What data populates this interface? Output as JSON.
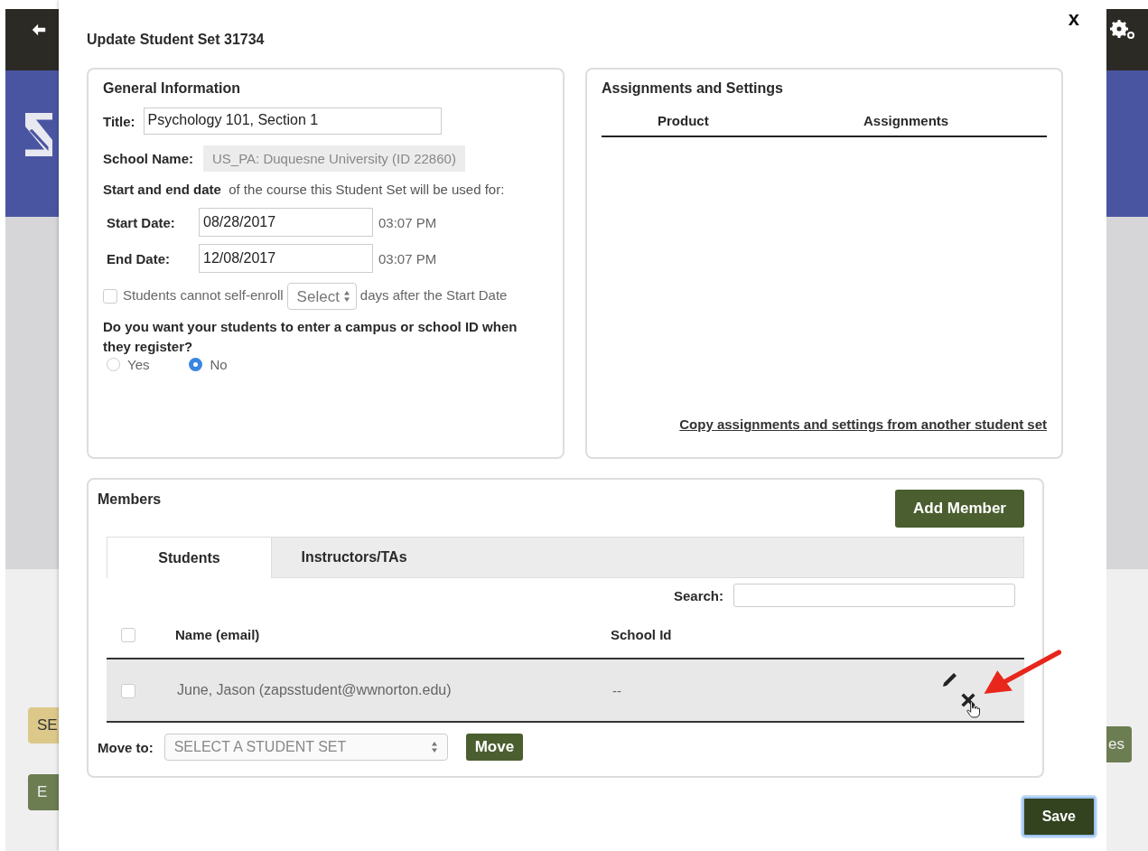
{
  "background": {
    "left_buttons": [
      "SE",
      "E"
    ],
    "right_buttons": [
      "es"
    ]
  },
  "dialog": {
    "title": "Update Student Set 31734",
    "close": "x"
  },
  "general_information": {
    "heading": "General Information",
    "title_label": "Title:",
    "title_value": "Psychology 101, Section 1",
    "school_label": "School Name:",
    "school_value": "US_PA: Duquesne University (ID 22860)",
    "dates_intro_bold": "Start and end date",
    "dates_intro_rest": "of the course this Student Set will be used for:",
    "dates": [
      {
        "label": "Start Date:",
        "value": "08/28/2017",
        "time": "03:07 PM"
      },
      {
        "label": "End Date:",
        "value": "12/08/2017",
        "time": "03:07 PM"
      }
    ],
    "self_enroll": {
      "checked": false,
      "label": "Students cannot self-enroll",
      "select": "Select",
      "after": "days after the Start Date"
    },
    "id_question": "Do you want your students to enter a campus or school ID when they register?",
    "id_options": [
      {
        "label": "Yes",
        "selected": false
      },
      {
        "label": "No",
        "selected": true
      }
    ]
  },
  "assignments": {
    "heading": "Assignments and Settings",
    "columns": [
      "Product",
      "Assignments"
    ],
    "copy_link": "Copy assignments and settings from another student set"
  },
  "members": {
    "heading": "Members",
    "add_button": "Add Member",
    "tabs": [
      {
        "label": "Students",
        "selected": true
      },
      {
        "label": "Instructors/TAs",
        "selected": false
      }
    ],
    "search_label": "Search:",
    "all_checked": false,
    "columns": [
      "Name (email)",
      "School Id"
    ],
    "rows": [
      {
        "checked": false,
        "name": "June, Jason (zapsstudent@wwnorton.edu)",
        "school_id": "--"
      }
    ],
    "move_label": "Move to:",
    "move_select": "SELECT A STUDENT SET",
    "move_button": "Move"
  },
  "save_button": "Save"
}
